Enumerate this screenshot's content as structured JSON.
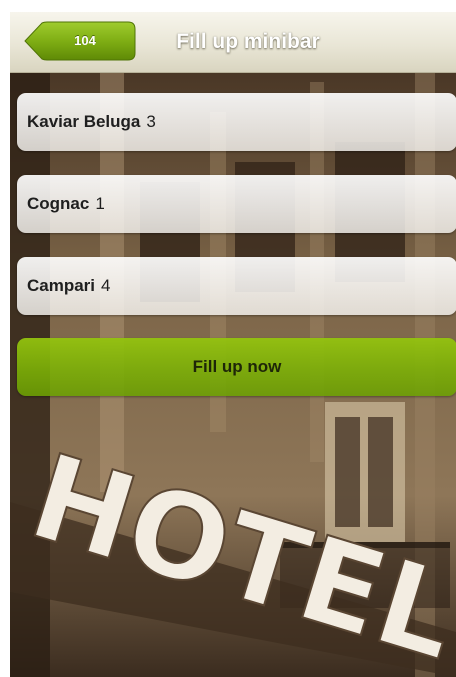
{
  "header": {
    "back_label": "104",
    "title": "Fill up minibar"
  },
  "items": [
    {
      "name": "Kaviar Beluga",
      "quantity": "3"
    },
    {
      "name": "Cognac",
      "quantity": "1"
    },
    {
      "name": "Campari",
      "quantity": "4"
    }
  ],
  "actions": {
    "fill_label": "Fill up now"
  },
  "background": {
    "sign_text": "HOTEL"
  },
  "colors": {
    "accent": "#8cbf0c",
    "header_bg": "#ece9da",
    "back_button": "#7fae14"
  }
}
